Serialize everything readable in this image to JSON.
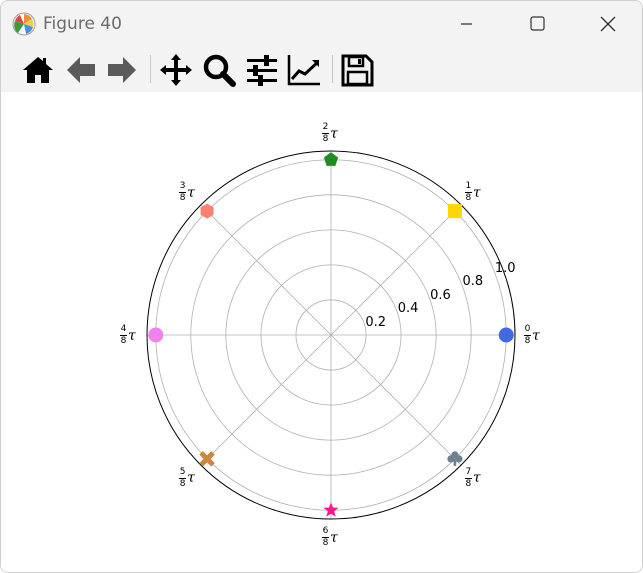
{
  "window": {
    "title": "Figure 40"
  },
  "icons": {
    "app": "matplotlib-icon",
    "minimize": "minimize-icon",
    "maximize": "maximize-icon",
    "close": "close-icon"
  },
  "toolbar": {
    "items": [
      "home-icon",
      "back-arrow-icon",
      "forward-arrow-icon",
      "pan-icon",
      "zoom-icon",
      "configure-subplots-icon",
      "edit-axes-icon",
      "save-icon"
    ]
  },
  "chart_data": {
    "type": "scatter",
    "projection": "polar",
    "rlim": [
      0,
      1.05
    ],
    "r_ticks": [
      0.2,
      0.4,
      0.6,
      0.8,
      1.0
    ],
    "r_tick_labels": [
      "0.2",
      "0.4",
      "0.6",
      "0.8",
      "1.0"
    ],
    "theta_tick_labels": [
      {
        "num": "0",
        "den": "8",
        "sym": "τ"
      },
      {
        "num": "1",
        "den": "8",
        "sym": "τ"
      },
      {
        "num": "2",
        "den": "8",
        "sym": "τ"
      },
      {
        "num": "3",
        "den": "8",
        "sym": "τ"
      },
      {
        "num": "4",
        "den": "8",
        "sym": "τ"
      },
      {
        "num": "5",
        "den": "8",
        "sym": "τ"
      },
      {
        "num": "6",
        "den": "8",
        "sym": "τ"
      },
      {
        "num": "7",
        "den": "8",
        "sym": "τ"
      }
    ],
    "grid": true,
    "points": [
      {
        "theta_fraction": 0.0,
        "r": 1.0,
        "marker": "circle",
        "color": "#4169E1"
      },
      {
        "theta_fraction": 0.125,
        "r": 1.0,
        "marker": "square",
        "color": "#FFD700"
      },
      {
        "theta_fraction": 0.25,
        "r": 1.0,
        "marker": "pentagon",
        "color": "#228B22"
      },
      {
        "theta_fraction": 0.375,
        "r": 1.0,
        "marker": "hexagon",
        "color": "#FA8072"
      },
      {
        "theta_fraction": 0.5,
        "r": 1.0,
        "marker": "circle",
        "color": "#EE82EE"
      },
      {
        "theta_fraction": 0.625,
        "r": 1.0,
        "marker": "x",
        "color": "#CD853F"
      },
      {
        "theta_fraction": 0.75,
        "r": 1.0,
        "marker": "star",
        "color": "#FF1493"
      },
      {
        "theta_fraction": 0.875,
        "r": 1.0,
        "marker": "club",
        "color": "#708090"
      }
    ]
  }
}
